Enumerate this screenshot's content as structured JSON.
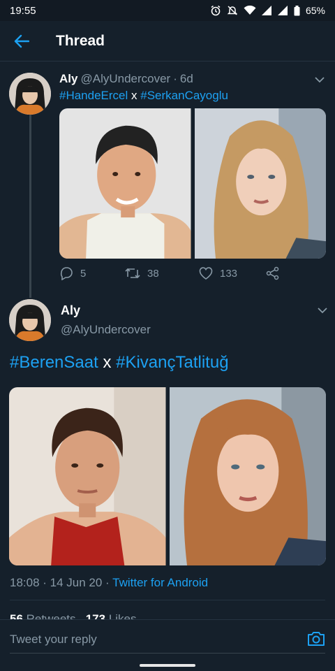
{
  "status_bar": {
    "time": "19:55",
    "battery": "65%"
  },
  "header": {
    "title": "Thread"
  },
  "tweet1": {
    "name": "Aly",
    "handle": "@AlyUndercover",
    "separator": "·",
    "age": "6d",
    "tag1": "#HandeErcel",
    "x": "x",
    "tag2": "#SerkanCayoglu",
    "replies": "5",
    "retweets": "38",
    "likes": "133"
  },
  "tweet2": {
    "name": "Aly",
    "handle": "@AlyUndercover",
    "tag1": "#BerenSaat",
    "x": "x",
    "tag2": "#KivançTatlituğ",
    "time": "18:08 · 14 Jun 20 · ",
    "source": "Twitter for Android",
    "retweets_count": "56",
    "retweets_label": "Retweets",
    "likes_count": "173",
    "likes_label": "Likes"
  },
  "reply": {
    "placeholder": "Tweet your reply"
  },
  "colors": {
    "background": "#15202b",
    "accent": "#1da1f2",
    "muted": "#8899a6"
  }
}
